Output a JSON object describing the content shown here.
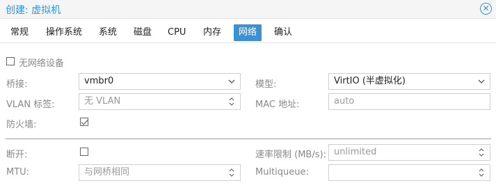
{
  "window": {
    "title": "创建: 虚拟机"
  },
  "tabs": [
    "常规",
    "操作系统",
    "系统",
    "磁盘",
    "CPU",
    "内存",
    "网络",
    "确认"
  ],
  "active_tab": "网络",
  "no_network": {
    "label": "无网络设备",
    "checked": false
  },
  "bridge": {
    "label": "桥接:",
    "value": "vmbr0"
  },
  "model": {
    "label": "模型:",
    "value": "VirtIO (半虚拟化)"
  },
  "vlan": {
    "label": "VLAN 标签:",
    "placeholder": "无 VLAN"
  },
  "mac": {
    "label": "MAC 地址:",
    "placeholder": "auto"
  },
  "firewall": {
    "label": "防火墙:",
    "checked": true
  },
  "disconnect": {
    "label": "断开:",
    "checked": false
  },
  "rate_limit": {
    "label": "速率限制 (MB/s):",
    "placeholder": "unlimited"
  },
  "mtu": {
    "label": "MTU:",
    "placeholder": "与网桥相同"
  },
  "multiqueue": {
    "label": "Multiqueue:",
    "value": ""
  },
  "colors": {
    "accent": "#3892d4"
  }
}
